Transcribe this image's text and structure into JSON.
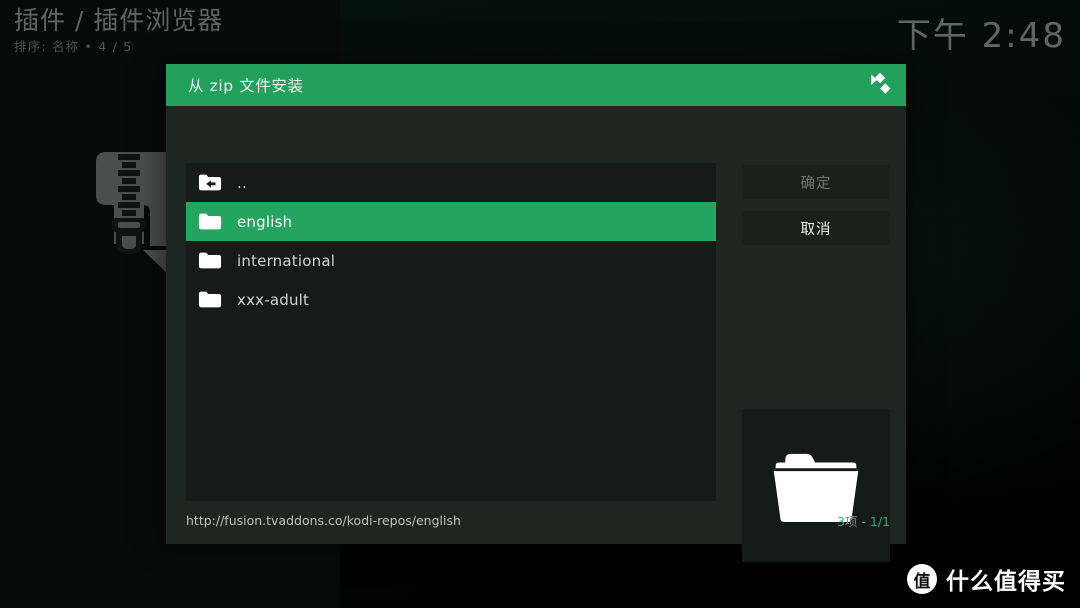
{
  "header": {
    "title": "插件 / 插件浏览器",
    "subtitle": "排序: 名称  •  4 / 5",
    "clock": "下午 2:48"
  },
  "dialog": {
    "title": "从 zip 文件安装",
    "logo_icon": "kodi-logo-icon",
    "accent_color": "#22a05c",
    "list": [
      {
        "label": "..",
        "icon": "folder-up-icon",
        "selected": false
      },
      {
        "label": "english",
        "icon": "folder-icon",
        "selected": true
      },
      {
        "label": "international",
        "icon": "folder-icon",
        "selected": false
      },
      {
        "label": "xxx-adult",
        "icon": "folder-icon",
        "selected": false
      }
    ],
    "buttons": {
      "ok": "确定",
      "cancel": "取消"
    },
    "thumbnail_icon": "folder-large-icon",
    "status": {
      "path": "http://fusion.tvaddons.co/kodi-repos/english",
      "count_number": "3",
      "count_unit": "项 - ",
      "page": "1/1"
    }
  },
  "background": {
    "art_icon": "zip-file-icon"
  },
  "watermark": {
    "badge": "值",
    "text": "什么值得买"
  }
}
